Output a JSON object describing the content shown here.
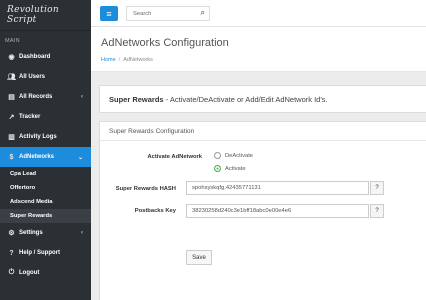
{
  "app": {
    "logo_text": "Revolution Script"
  },
  "sidebar": {
    "section_label": "MAIN",
    "items": [
      {
        "label": "Dashboard",
        "icon": "dashboard-icon"
      },
      {
        "label": "All Users",
        "icon": "users-icon"
      },
      {
        "label": "All Records",
        "icon": "records-icon"
      },
      {
        "label": "Tracker",
        "icon": "tracker-icon"
      },
      {
        "label": "Activity Logs",
        "icon": "activity-icon"
      },
      {
        "label": "AdNetworks",
        "icon": "dollar-icon"
      },
      {
        "label": "Settings",
        "icon": "settings-icon"
      },
      {
        "label": "Help / Support",
        "icon": "help-icon"
      },
      {
        "label": "Logout",
        "icon": "power-icon"
      }
    ],
    "adnetworks_sub": [
      "Cpa Lead",
      "Offertoro",
      "Adscend Media",
      "Super Rewards"
    ]
  },
  "topbar": {
    "search_placeholder": "Search"
  },
  "page": {
    "title": "AdNetworks Configuration",
    "breadcrumb_home": "Home",
    "breadcrumb_current": "AdNetworks"
  },
  "panel_main": {
    "title_bold": "Super Rewards",
    "title_rest": " - Activate/DeActivate or Add/Edit AdNetwork Id's."
  },
  "config": {
    "header": "Super Rewards Configuration",
    "activate_label": "Activate AdNetwork",
    "option_deactivate": "DeActivate",
    "option_activate": "Activate",
    "selected": "Activate",
    "hash_label": "Super Rewards HASH",
    "hash_value": "spohsyskqfg,42435771131",
    "postback_label": "Postbacks Key",
    "postback_value": "38230258d240c3e1bff18abc0e00e4e6",
    "help_glyph": "?",
    "save_label": "Save"
  },
  "colors": {
    "accent": "#1e8cdc",
    "sidebar_bg": "#2b3035",
    "radio_active": "#4caf50"
  }
}
